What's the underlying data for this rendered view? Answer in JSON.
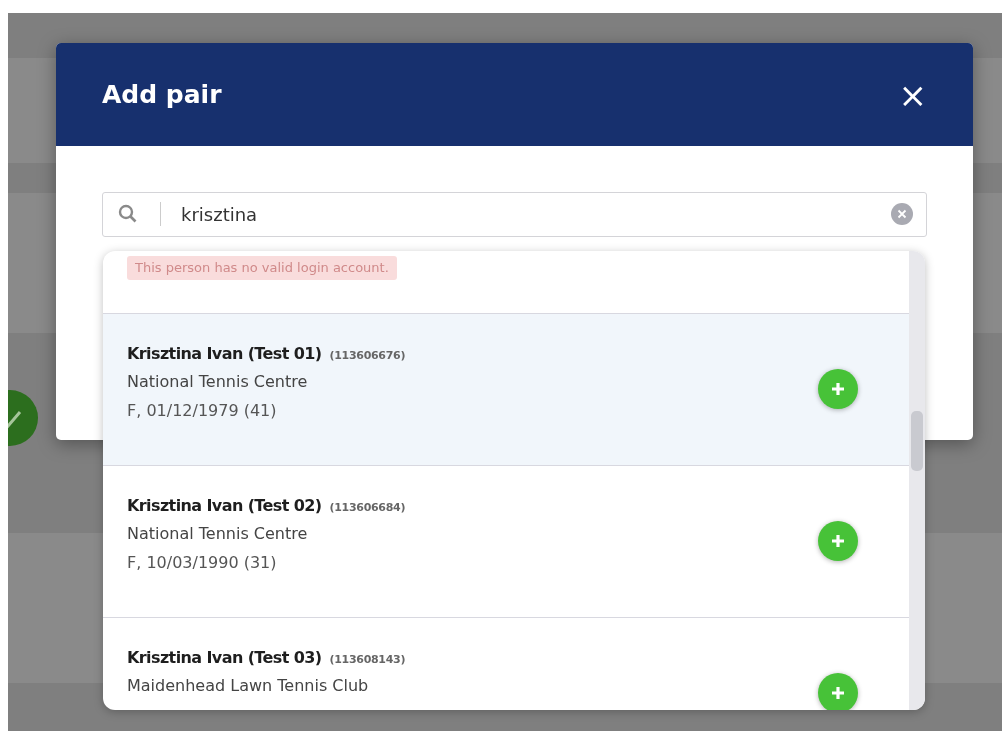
{
  "modal": {
    "title": "Add pair",
    "close": "×"
  },
  "search": {
    "value": "krisztina"
  },
  "results": [
    {
      "kind": "notice",
      "text": "This person has no valid login account.",
      "selected": false
    },
    {
      "kind": "player",
      "name": "Krisztina Ivan (Test 01)",
      "id": "(113606676)",
      "club": "National Tennis Centre",
      "details": "F, 01/12/1979 (41)",
      "selected": true
    },
    {
      "kind": "player",
      "name": "Krisztina Ivan (Test 02)",
      "id": "(113606684)",
      "club": "National Tennis Centre",
      "details": "F, 10/03/1990 (31)",
      "selected": false
    },
    {
      "kind": "player",
      "name": "Krisztina Ivan (Test 03)",
      "id": "(113608143)",
      "club": "Maidenhead Lawn Tennis Club",
      "selected": false
    }
  ]
}
